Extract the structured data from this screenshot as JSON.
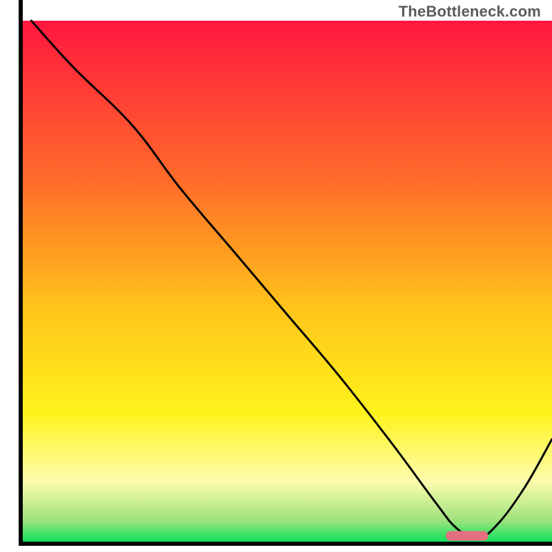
{
  "watermark": "TheBottleneck.com",
  "chart_data": {
    "type": "line",
    "xlim": [
      0,
      100
    ],
    "ylim": [
      0,
      100
    ],
    "grid": false,
    "legend": false,
    "background_gradient": {
      "stops": [
        {
          "offset": 0.0,
          "color": "#ff173e"
        },
        {
          "offset": 0.3,
          "color": "#ff6a2a"
        },
        {
          "offset": 0.55,
          "color": "#ffc41a"
        },
        {
          "offset": 0.75,
          "color": "#fff31c"
        },
        {
          "offset": 0.88,
          "color": "#fdfcad"
        },
        {
          "offset": 0.955,
          "color": "#9fe27e"
        },
        {
          "offset": 1.0,
          "color": "#00e15a"
        }
      ]
    },
    "curve": {
      "x": [
        2,
        10,
        21,
        30,
        40,
        50,
        60,
        70,
        78,
        82,
        86,
        90,
        95,
        100
      ],
      "y": [
        100,
        91,
        80,
        68,
        56,
        44,
        32,
        19,
        8,
        3,
        1,
        4,
        11,
        20
      ]
    },
    "marker": {
      "x_start": 80,
      "x_end": 88,
      "y": 1.5,
      "color": "#e2707e"
    }
  }
}
